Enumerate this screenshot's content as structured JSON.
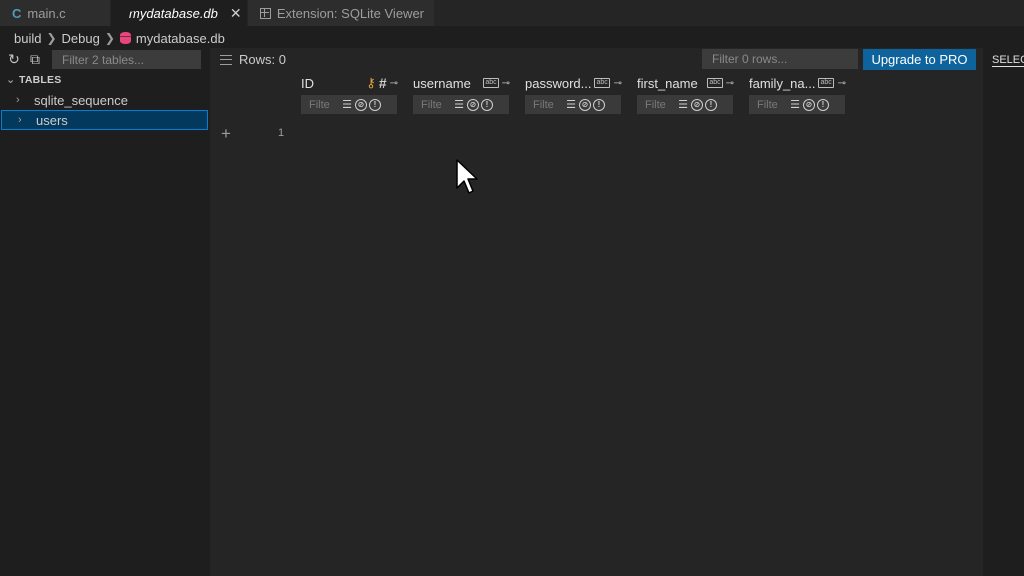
{
  "tabs": [
    {
      "label": "main.c",
      "icon": "c-file-icon"
    },
    {
      "label": "mydatabase.db",
      "icon": "database-icon",
      "active": true
    },
    {
      "label": "Extension: SQLite Viewer",
      "icon": "extension-grid-icon"
    }
  ],
  "breadcrumb": {
    "items": [
      "build",
      "Debug",
      "mydatabase.db"
    ]
  },
  "sidebar": {
    "filter_placeholder": "Filter 2 tables...",
    "section_title": "TABLES",
    "tables": [
      {
        "label": "sqlite_sequence",
        "selected": false
      },
      {
        "label": "users",
        "selected": true
      }
    ]
  },
  "toolbar": {
    "rows_label": "Rows: 0",
    "filter_placeholder": "Filter 0 rows...",
    "upgrade_label": "Upgrade to PRO"
  },
  "grid": {
    "columns": [
      {
        "name": "ID",
        "type_icon": "hash-icon",
        "primary_key": true
      },
      {
        "name": "username",
        "type_icon": "text-type-icon"
      },
      {
        "name": "password...",
        "type_icon": "text-type-icon"
      },
      {
        "name": "first_name",
        "type_icon": "text-type-icon"
      },
      {
        "name": "family_na...",
        "type_icon": "text-type-icon"
      }
    ],
    "column_filter_placeholder": "Filte",
    "new_row_number": "1"
  },
  "right_panel": {
    "label": "SELECT"
  },
  "colors": {
    "accent": "#0e639c",
    "selection": "#04395e",
    "db_icon": "#e8467c",
    "key": "#e2a33f"
  }
}
